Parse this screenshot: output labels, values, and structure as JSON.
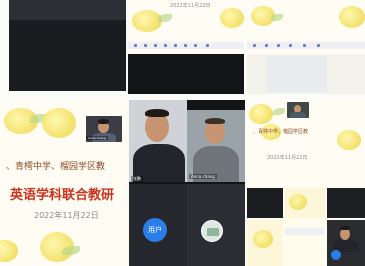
{
  "top_left": {
    "name": ""
  },
  "top_middle": {
    "date": "2022年11月22日"
  },
  "top_right": {
    "name": ""
  },
  "main_slide": {
    "school_line": "、青樗中学、榴园学区教",
    "title": "英语学科联合教研",
    "date": "2022年11月22日",
    "thumb_name": "Anna chang"
  },
  "video_call": {
    "left_name": "张鹏",
    "right_name": "Anna chang",
    "user_button": "用户"
  },
  "right_slide": {
    "school_line": "、青樗中学、榴园学区教",
    "date": "2022年11月22日"
  },
  "colors": {
    "accent": "#2a7ee8",
    "title_red": "#c8321e",
    "text_gray": "#8a8a8a",
    "slide_bg": "#fffdf3",
    "dark_bg": "#2d2f34"
  }
}
